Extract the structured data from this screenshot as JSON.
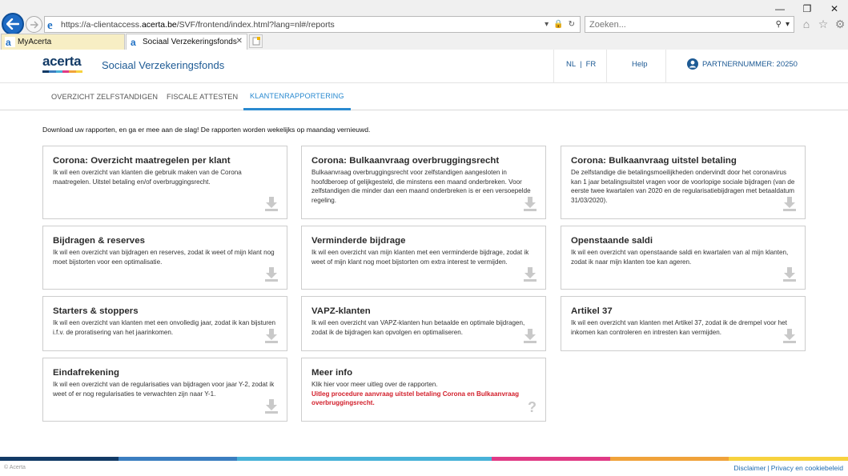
{
  "browser": {
    "url_prefix": "https://a-clientaccess.",
    "url_domain": "acerta.be",
    "url_suffix": "/SVF/frontend/index.html?lang=nl#/reports",
    "search_placeholder": "Zoeken...",
    "tabs": [
      {
        "label": "MyAcerta"
      },
      {
        "label": "Sociaal Verzekeringsfonds"
      }
    ]
  },
  "header": {
    "logo": "acerta",
    "site_title": "Sociaal Verzekeringsfonds",
    "lang_nl": "NL",
    "lang_sep": "|",
    "lang_fr": "FR",
    "help": "Help",
    "partner": "PARTNERNUMMER: 20250"
  },
  "nav": {
    "items": [
      {
        "label": "OVERZICHT ZELFSTANDIGEN"
      },
      {
        "label": "FISCALE ATTESTEN"
      },
      {
        "label": "KLANTENRAPPORTERING"
      }
    ]
  },
  "intro": "Download uw rapporten, en ga er mee aan de slag! De rapporten worden wekelijks op maandag vernieuwd.",
  "cards": [
    {
      "title": "Corona: Overzicht maatregelen per klant",
      "text": "Ik wil een overzicht van klanten die gebruik maken van de Corona maatregelen. Uitstel betaling en/of overbruggingsrecht."
    },
    {
      "title": "Corona: Bulkaanvraag overbruggingsrecht",
      "text": "Bulkaanvraag overbruggingsrecht voor zelfstandigen aangesloten in hoofdberoep of gelijkgesteld, die minstens een maand onderbreken. Voor zelfstandigen die minder dan een maand onderbreken is er een versoepelde regeling."
    },
    {
      "title": "Corona: Bulkaanvraag uitstel betaling",
      "text": "De zelfstandige die betalingsmoeilijkheden ondervindt door het coronavirus kan 1 jaar betalingsuitstel vragen voor de voorlopige sociale bijdragen (van de eerste twee kwartalen van 2020 en de regularisatiebijdragen met betaaldatum 31/03/2020)."
    },
    {
      "title": "Bijdragen & reserves",
      "text": "Ik wil een overzicht van bijdragen en reserves, zodat ik weet of mijn klant nog moet bijstorten voor een optimalisatie."
    },
    {
      "title": "Verminderde bijdrage",
      "text": "Ik wil een overzicht van mijn klanten met een verminderde bijdrage, zodat ik weet of mijn klant nog moet bijstorten om extra interest te vermijden."
    },
    {
      "title": "Openstaande saldi",
      "text": "Ik wil een overzicht van openstaande saldi en kwartalen van al mijn klanten, zodat ik naar mijn klanten toe kan ageren."
    },
    {
      "title": "Starters & stoppers",
      "text": "Ik wil een overzicht van klanten met een onvolledig jaar, zodat ik kan bijsturen i.f.v. de proratisering van het jaarinkomen."
    },
    {
      "title": "VAPZ-klanten",
      "text": "Ik wil een overzicht van VAPZ-klanten hun betaalde en optimale bijdragen, zodat ik de bijdragen kan opvolgen en optimaliseren."
    },
    {
      "title": "Artikel 37",
      "text": "Ik wil een overzicht van klanten met Artikel 37, zodat ik de drempel voor het inkomen kan controleren en intresten kan vermijden."
    },
    {
      "title": "Eindafrekening",
      "text": "Ik wil een overzicht van de regularisaties van bijdragen voor jaar Y-2, zodat ik weet of er nog regularisaties te verwachten zijn naar Y-1."
    }
  ],
  "info_card": {
    "title": "Meer info",
    "text": "Klik hier voor meer uitleg over de rapporten.",
    "link": "Uitleg procedure aanvraag uitstel betaling Corona en Bulkaanvraag overbruggingsrecht."
  },
  "footer": {
    "copyright": "© Acerta",
    "disclaimer": "Disclaimer",
    "sep": "|",
    "privacy": "Privacy en cookiebeleid"
  },
  "colors": {
    "brand_blue": "#1d5a94",
    "nav_active": "#2a8ad0",
    "info_red": "#d21f2b",
    "strip": [
      "#123a66",
      "#3b7ec0",
      "#48b2d8",
      "#e03a85",
      "#f0a23a",
      "#f7d23e"
    ]
  },
  "icons": {
    "back": "back-arrow-icon",
    "download": "download-icon",
    "info": "question-mark-icon"
  }
}
